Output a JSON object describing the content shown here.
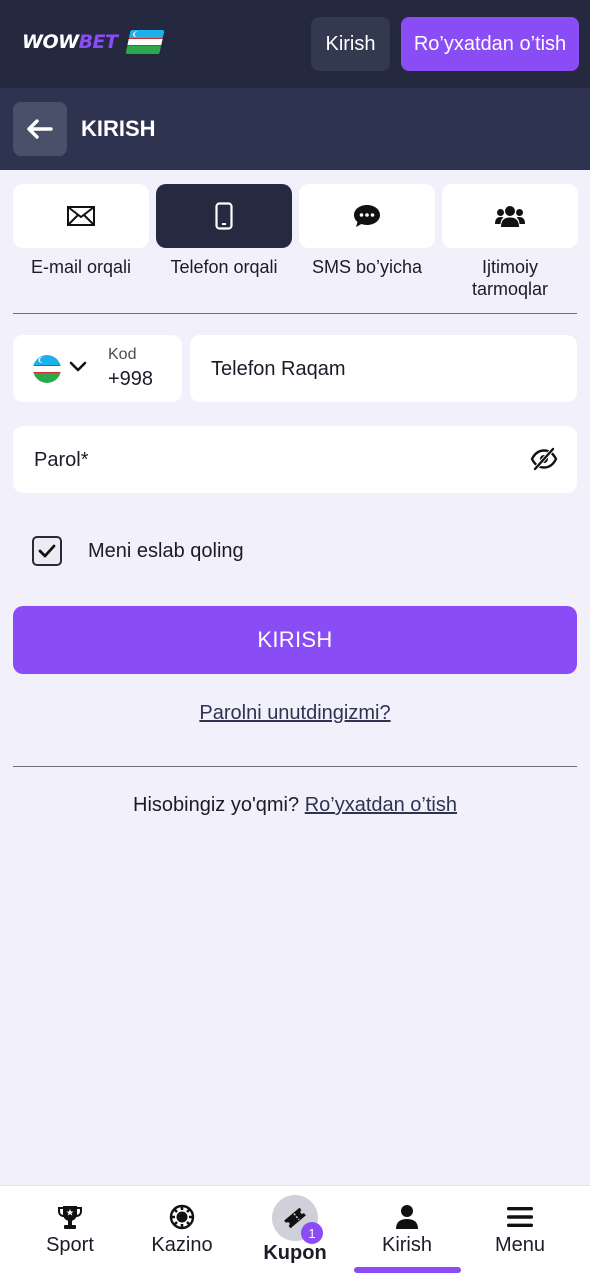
{
  "header": {
    "logo_wow": "WOW",
    "logo_bet": "BET",
    "login_label": "Kirish",
    "register_label": "Ro’yxatdan o’tish"
  },
  "subheader": {
    "title": "KIRISH"
  },
  "methods": [
    {
      "label": "E-mail orqali",
      "icon": "envelope-icon",
      "active": false
    },
    {
      "label": "Telefon orqali",
      "icon": "smartphone-icon",
      "active": true
    },
    {
      "label": "SMS bo’yicha",
      "icon": "chat-bubble-icon",
      "active": false
    },
    {
      "label": "Ijtimoiy tarmoqlar",
      "icon": "users-icon",
      "active": false
    }
  ],
  "phone": {
    "code_label": "Kod",
    "code_value": "+998",
    "placeholder": "Telefon Raqam"
  },
  "password": {
    "placeholder": "Parol*"
  },
  "remember": {
    "label": "Meni eslab qoling",
    "checked": true
  },
  "submit_label": "KIRISH",
  "forgot_label": "Parolni unutdingizmi?",
  "no_account": {
    "text": "Hisobingiz yo'qmi?",
    "link": "Ro’yxatdan o’tish"
  },
  "bottom_nav": [
    {
      "label": "Sport",
      "icon": "trophy-icon"
    },
    {
      "label": "Kazino",
      "icon": "casino-chip-icon"
    },
    {
      "label": "Kupon",
      "icon": "ticket-icon",
      "badge": "1"
    },
    {
      "label": "Kirish",
      "icon": "user-icon",
      "active": true
    },
    {
      "label": "Menu",
      "icon": "hamburger-icon"
    }
  ],
  "colors": {
    "accent": "#8a4cf5",
    "header_bg": "#242940",
    "subheader_bg": "#2e3450",
    "page_bg": "#f1f0fb"
  }
}
